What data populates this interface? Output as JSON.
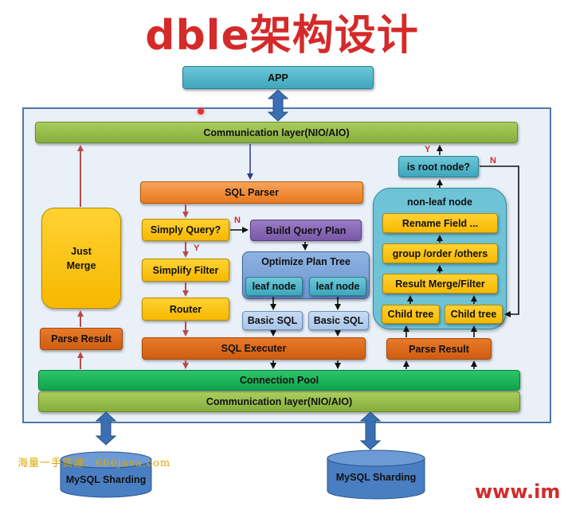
{
  "title": "dble架构设计",
  "app": "APP",
  "comm_top": "Communication layer(NIO/AIO)",
  "comm_bottom": "Communication layer(NIO/AIO)",
  "sql_parser": "SQL Parser",
  "simply_query": "Simply Query?",
  "simplify_filter": "Simplify  Filter",
  "router": "Router",
  "sql_executer": "SQL Executer",
  "build_query_plan": "Build Query Plan",
  "optimize_plan_tree": "Optimize Plan Tree",
  "leaf_node_1": "leaf node",
  "leaf_node_2": "leaf node",
  "basic_sql_1": "Basic SQL",
  "basic_sql_2": "Basic SQL",
  "just_merge": [
    "Just",
    "Merge"
  ],
  "parse_result_left": "Parse Result",
  "parse_result_right": "Parse Result",
  "connection_pool": "Connection Pool",
  "is_root_node": "is root node?",
  "non_leaf_node": "non-leaf node",
  "rename_field": "Rename Field ...",
  "group_order": "group /order /others",
  "result_merge": "Result Merge/Filter",
  "child_tree_1": "Child tree",
  "child_tree_2": "Child tree",
  "mysql_left": "MySQL Sharding",
  "mysql_right": "MySQL Sharding",
  "label_n1": "N",
  "label_y1": "Y",
  "label_n2": "N",
  "label_y2": "Y",
  "watermark": "海量一手资源：666java.com",
  "website": "www.im",
  "colors": {
    "title": "#d42a2a",
    "panel_bg": "#e9f0f8",
    "arrow_red": "#b64a4a",
    "arrow_dark": "#111111",
    "arrow_blue": "#2a3a8a"
  }
}
